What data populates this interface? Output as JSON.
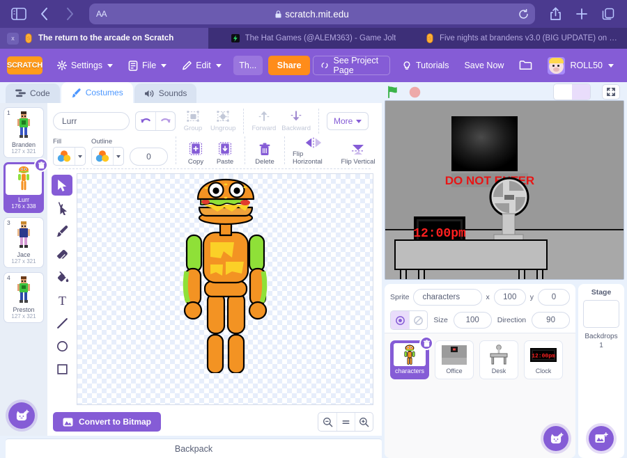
{
  "browser": {
    "url": "scratch.mit.edu",
    "aa_label": "AA",
    "lock_icon": "lock-icon",
    "tabs": [
      {
        "title": "The return to the arcade on Scratch",
        "favicon": "scratch-favicon",
        "active": true,
        "close_label": "x"
      },
      {
        "title": "The Hat Games (@ALEM363) - Game Jolt",
        "favicon": "gamejolt-favicon",
        "active": false
      },
      {
        "title": "Five nights at brandens v3.0 (BIG UPDATE) on S...",
        "favicon": "scratch-favicon",
        "active": false
      }
    ]
  },
  "menu": {
    "logo": "SCRATCH",
    "settings_label": "Settings",
    "file_label": "File",
    "edit_label": "Edit",
    "project_title": "Th...",
    "share_label": "Share",
    "project_page_label": "See Project Page",
    "tutorials_label": "Tutorials",
    "save_now_label": "Save Now",
    "folder_icon": "folder-icon",
    "username": "ROLL50"
  },
  "editor_tabs": [
    {
      "label": "Code",
      "icon": "code-icon",
      "active": false
    },
    {
      "label": "Costumes",
      "icon": "brush-icon",
      "active": true
    },
    {
      "label": "Sounds",
      "icon": "speaker-icon",
      "active": false
    }
  ],
  "costumes": [
    {
      "number": "1",
      "name": "Branden",
      "size": "127 x 321",
      "selected": false
    },
    {
      "number": "2",
      "name": "Lurr",
      "size": "176 x 338",
      "selected": true
    },
    {
      "number": "3",
      "name": "Jace",
      "size": "127 x 321",
      "selected": false
    },
    {
      "number": "4",
      "name": "Preston",
      "size": "127 x 321",
      "selected": false
    }
  ],
  "add_costume_label": "add-costume",
  "paint": {
    "costume_name": "Lurr",
    "undo_label": "undo",
    "redo_label": "redo",
    "group_label": "Group",
    "ungroup_label": "Ungroup",
    "forward_label": "Forward",
    "backward_label": "Backward",
    "more_label": "More",
    "fill_label": "Fill",
    "outline_label": "Outline",
    "outline_width": "0",
    "copy_label": "Copy",
    "paste_label": "Paste",
    "delete_label": "Delete",
    "flip_h_label": "Flip Horizontal",
    "flip_v_label": "Flip Vertical",
    "convert_label": "Convert to Bitmap",
    "zoom_out_label": "zoom-out",
    "zoom_reset_label": "=",
    "zoom_in_label": "zoom-in",
    "tools": [
      {
        "name": "select",
        "active": true
      },
      {
        "name": "reshape",
        "active": false
      },
      {
        "name": "brush",
        "active": false
      },
      {
        "name": "eraser",
        "active": false
      },
      {
        "name": "fill",
        "active": false
      },
      {
        "name": "text",
        "active": false
      },
      {
        "name": "line",
        "active": false
      },
      {
        "name": "circle",
        "active": false
      },
      {
        "name": "rectangle",
        "active": false
      }
    ]
  },
  "backpack_label": "Backpack",
  "stage_controls": {
    "green_flag_label": "go",
    "stop_label": "stop",
    "small_stage_label": "small-stage",
    "large_stage_label": "large-stage",
    "fullscreen_label": "fullscreen"
  },
  "stage_scene": {
    "sign_text": "DO NOT ENTER",
    "clock_text": "12:00pm"
  },
  "sprite_info": {
    "sprite_label": "Sprite",
    "sprite_name": "characters",
    "x_label": "x",
    "x_value": "100",
    "y_label": "y",
    "y_value": "0",
    "size_label": "Size",
    "size_value": "100",
    "direction_label": "Direction",
    "direction_value": "90",
    "show_label": "show",
    "hide_label": "hide"
  },
  "sprites": [
    {
      "name": "characters",
      "thumb": "robot-thumb",
      "selected": true
    },
    {
      "name": "Office",
      "thumb": "office-thumb",
      "selected": false
    },
    {
      "name": "Desk",
      "thumb": "desk-thumb",
      "selected": false
    },
    {
      "name": "Clock",
      "thumb": "clock-thumb",
      "selected": false
    }
  ],
  "add_sprite_label": "add-sprite",
  "stage_panel": {
    "title": "Stage",
    "backdrops_label": "Backdrops",
    "backdrops_count": "1",
    "add_backdrop_label": "add-backdrop"
  },
  "colors": {
    "scratch_purple": "#855cd6",
    "browser_purple": "#4b3a8f",
    "share_orange": "#ff8c1a",
    "accent_blue": "#4c97ff",
    "text_gray": "#575e75"
  }
}
